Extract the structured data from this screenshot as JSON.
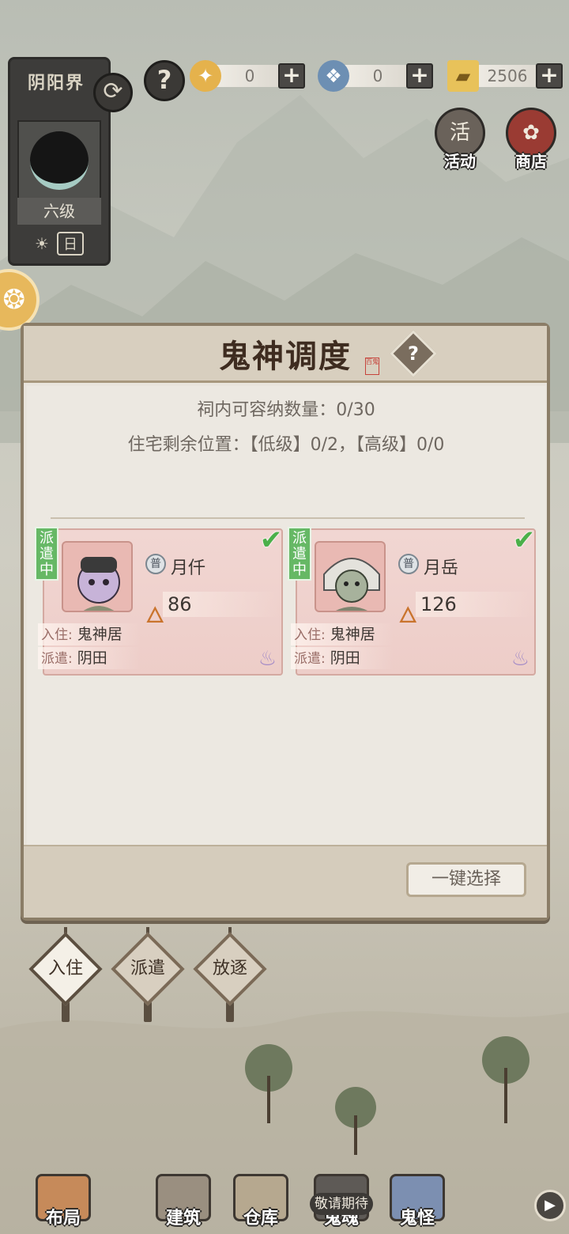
{
  "realm": {
    "title": "阴阳界",
    "level": "六级",
    "time_label": "日"
  },
  "currencies": [
    {
      "icon": "golden-spirit-icon",
      "value": "0"
    },
    {
      "icon": "blue-spirit-icon",
      "value": "0"
    },
    {
      "icon": "gold-ingot-icon",
      "value": "2506"
    }
  ],
  "top_buttons": {
    "activity": "活动",
    "shop": "商店",
    "activity_glyph": "活"
  },
  "panel": {
    "title": "鬼神调度",
    "seal": "百鬼",
    "capacity": "祠内可容纳数量：0/30",
    "housing": "住宅剩余位置：【低级】0/2，【高级】0/0",
    "one_click": "一键选择"
  },
  "cards": [
    {
      "status": "派遣中",
      "grade": "普",
      "name": "月仟",
      "power": "86",
      "live_key": "入住:",
      "live_val": "鬼神居",
      "dispatch_key": "派遣:",
      "dispatch_val": "阴田"
    },
    {
      "status": "派遣中",
      "grade": "普",
      "name": "月岳",
      "power": "126",
      "live_key": "入住:",
      "live_val": "鬼神居",
      "dispatch_key": "派遣:",
      "dispatch_val": "阴田"
    }
  ],
  "tabs": [
    "入住",
    "派遣",
    "放逐"
  ],
  "nav": [
    "布局",
    "建筑",
    "仓库",
    "鬼魂",
    "鬼怪"
  ],
  "nav_badge": "敬请期待"
}
